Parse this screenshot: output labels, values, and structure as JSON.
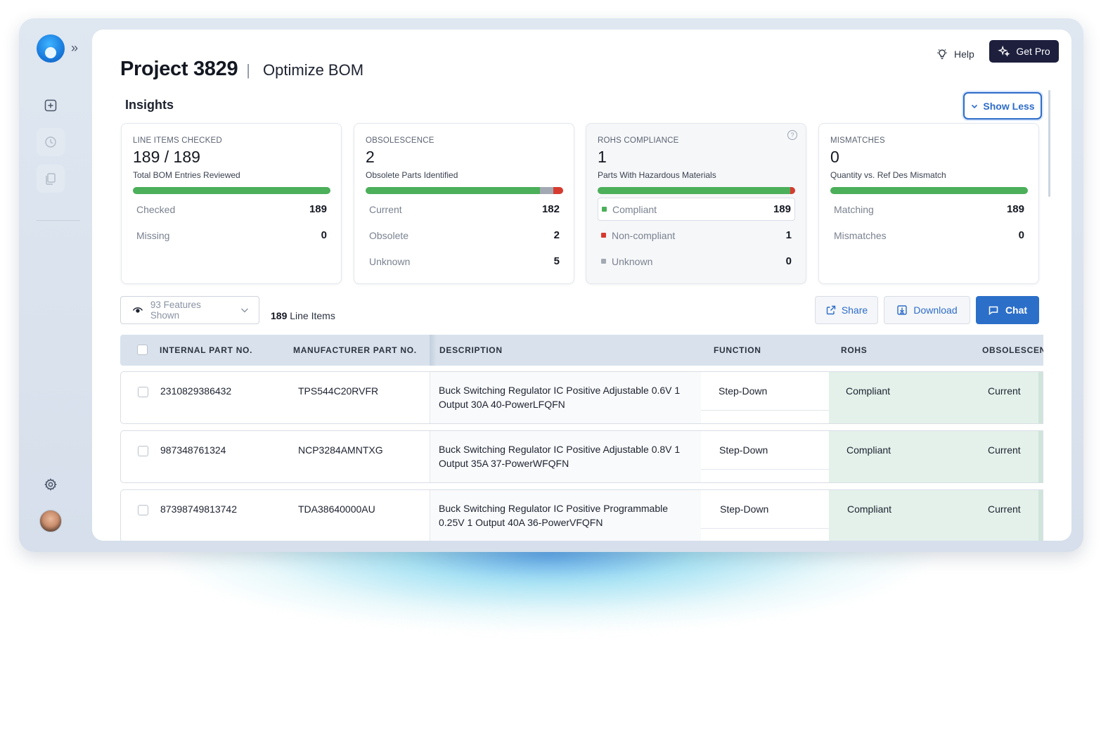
{
  "header": {
    "project_title": "Project 3829",
    "separator": "|",
    "page_subtitle": "Optimize BOM",
    "help_label": "Help",
    "get_pro_label": "Get Pro"
  },
  "insights": {
    "label": "Insights",
    "show_less_label": "Show Less",
    "cards": [
      {
        "label": "LINE ITEMS CHECKED",
        "value": "189 / 189",
        "subtitle": "Total BOM Entries Reviewed",
        "bar": [
          {
            "fraction": 1.0,
            "color": "#4caf5a"
          }
        ],
        "rows": [
          {
            "label": "Checked",
            "value": "189"
          },
          {
            "label": "Missing",
            "value": "0"
          }
        ]
      },
      {
        "label": "OBSOLESCENCE",
        "value": "2",
        "subtitle": "Obsolete Parts Identified",
        "bar": [
          {
            "fraction": 0.883,
            "color": "#4caf5a"
          },
          {
            "fraction": 0.066,
            "color": "#a3a9b3"
          },
          {
            "fraction": 0.051,
            "color": "#d63b30"
          }
        ],
        "rows": [
          {
            "label": "Current",
            "value": "182"
          },
          {
            "label": "Obsolete",
            "value": "2"
          },
          {
            "label": "Unknown",
            "value": "5"
          }
        ]
      },
      {
        "label": "ROHS COMPLIANCE",
        "value": "1",
        "subtitle": "Parts With Hazardous Materials",
        "bar": [
          {
            "fraction": 0.975,
            "color": "#4caf5a"
          },
          {
            "fraction": 0.025,
            "color": "#d63b30"
          }
        ],
        "rows": [
          {
            "label": "Compliant",
            "value": "189",
            "dot": "#4caf5a"
          },
          {
            "label": "Non-compliant",
            "value": "1",
            "dot": "#d63b30"
          },
          {
            "label": "Unknown",
            "value": "0",
            "dot": "#a3a9b3"
          }
        ]
      },
      {
        "label": "MISMATCHES",
        "value": "0",
        "subtitle": "Quantity vs. Ref Des Mismatch",
        "bar": [
          {
            "fraction": 1.0,
            "color": "#4caf5a"
          }
        ],
        "rows": [
          {
            "label": "Matching",
            "value": "189"
          },
          {
            "label": "Mismatches",
            "value": "0"
          }
        ]
      }
    ]
  },
  "toolbar": {
    "features_label": "93 Features Shown",
    "line_items_count": "189",
    "line_items_label": "Line Items",
    "share_label": "Share",
    "download_label": "Download",
    "chat_label": "Chat"
  },
  "table": {
    "columns": [
      "INTERNAL PART NO.",
      "MANUFACTURER PART NO.",
      "DESCRIPTION",
      "FUNCTION",
      "ROHS",
      "OBSOLESCENCE"
    ],
    "rows": [
      {
        "internal": "2310829386432",
        "mfr": "TPS544C20RVFR",
        "description": "Buck Switching Regulator IC Positive Adjustable 0.6V 1 Output 30A 40-PowerLFQFN",
        "function": "Step-Down",
        "rohs": "Compliant",
        "obsolescence": "Current"
      },
      {
        "internal": "987348761324",
        "mfr": "NCP3284AMNTXG",
        "description": "Buck Switching Regulator IC Positive Adjustable 0.8V 1 Output 35A 37-PowerWFQFN",
        "function": "Step-Down",
        "rohs": "Compliant",
        "obsolescence": "Current"
      },
      {
        "internal": "87398749813742",
        "mfr": "TDA38640000AU",
        "description": "Buck Switching Regulator IC Positive Programmable 0.25V 1 Output 40A 36-PowerVFQFN",
        "function": "Step-Down",
        "rohs": "Compliant",
        "obsolescence": "Current"
      }
    ]
  },
  "icons": {
    "logo": "app-logo",
    "expand": "double-chevron-right-icon",
    "new": "plus-square-icon",
    "history": "history-icon",
    "documents": "copy-icon",
    "settings": "gear-icon",
    "help": "lightbulb-icon",
    "pro": "sparkle-icon"
  }
}
